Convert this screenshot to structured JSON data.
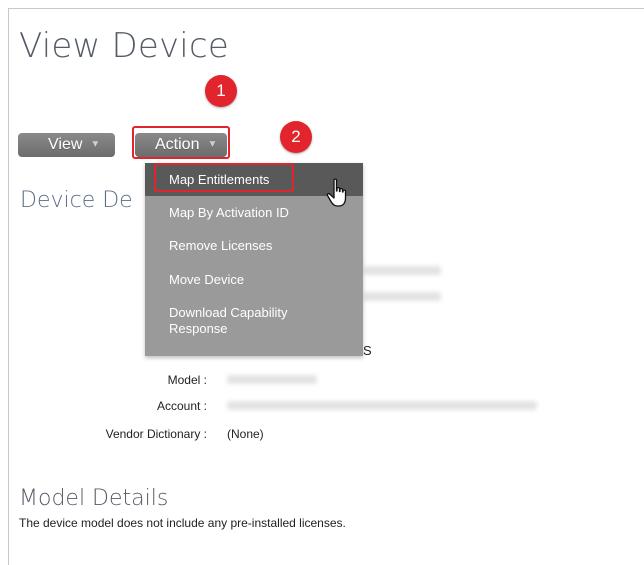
{
  "page": {
    "title": "View Device"
  },
  "toolbar": {
    "view_label": "View",
    "action_label": "Action",
    "caret": "▼"
  },
  "callouts": {
    "one": "1",
    "two": "2"
  },
  "action_menu": {
    "items": [
      {
        "label": "Map Entitlements",
        "active": true
      },
      {
        "label": "Map By Activation ID",
        "active": false
      },
      {
        "label": "Remove Licenses",
        "active": false
      },
      {
        "label": "Move Device",
        "active": false
      },
      {
        "label": "Download Capability Response",
        "active": false
      }
    ]
  },
  "device_details": {
    "title": "Device De",
    "partial_value": "S",
    "fields": [
      {
        "label": "Model :",
        "value": ""
      },
      {
        "label": "Account :",
        "value": ""
      },
      {
        "label": "Vendor Dictionary :",
        "value": "(None)"
      }
    ]
  },
  "model_details": {
    "title": "Model Details",
    "text": "The device model does not include any pre-installed licenses."
  },
  "colors": {
    "accent_red": "#e2242c",
    "button_gray": "#7a7a7a",
    "menu_bg": "#9a9a9a",
    "menu_active": "#595959"
  },
  "icons": {
    "cursor": "hand-pointer-icon"
  }
}
